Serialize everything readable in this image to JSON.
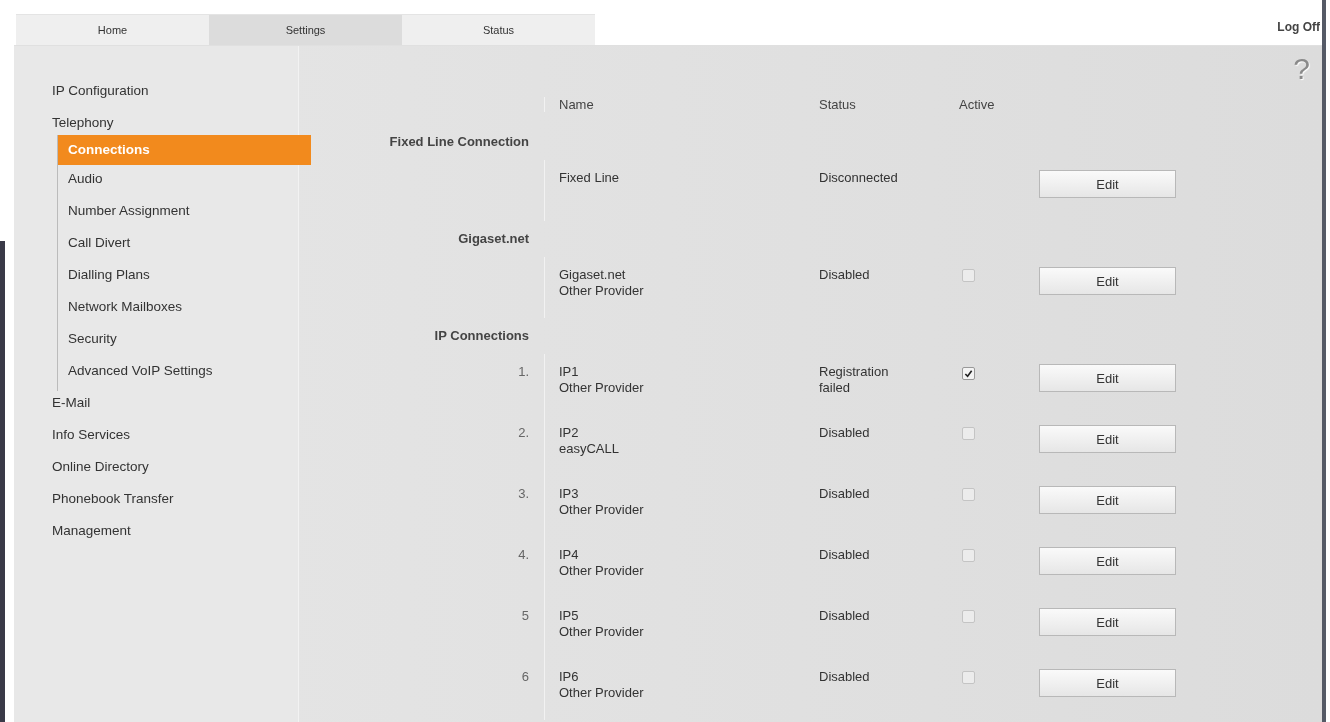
{
  "tabs": [
    {
      "label": "Home",
      "selected": false
    },
    {
      "label": "Settings",
      "selected": true
    },
    {
      "label": "Status",
      "selected": false
    }
  ],
  "log_off": "Log Off",
  "help": "?",
  "sidebar": {
    "items": [
      {
        "label": "IP Configuration",
        "selected": false
      },
      {
        "label": "Telephony",
        "selected": false,
        "children": [
          {
            "label": "Connections",
            "selected": true
          },
          {
            "label": "Audio",
            "selected": false
          },
          {
            "label": "Number Assignment",
            "selected": false
          },
          {
            "label": "Call Divert",
            "selected": false
          },
          {
            "label": "Dialling Plans",
            "selected": false
          },
          {
            "label": "Network Mailboxes",
            "selected": false
          },
          {
            "label": "Security",
            "selected": false
          },
          {
            "label": "Advanced VoIP Settings",
            "selected": false
          }
        ]
      },
      {
        "label": "E-Mail",
        "selected": false
      },
      {
        "label": "Info Services",
        "selected": false
      },
      {
        "label": "Online Directory",
        "selected": false
      },
      {
        "label": "Phonebook Transfer",
        "selected": false
      },
      {
        "label": "Management",
        "selected": false
      }
    ]
  },
  "table": {
    "columns": [
      "Name",
      "Status",
      "Active"
    ],
    "sections": [
      {
        "title": "Fixed Line Connection",
        "rows": [
          {
            "name": [
              "Fixed Line"
            ],
            "status": "Disconnected",
            "button": "Edit"
          }
        ]
      },
      {
        "title": "Gigaset.net",
        "rows": [
          {
            "name": [
              "Gigaset.net",
              "Other Provider"
            ],
            "status": "Disabled",
            "active": false,
            "button": "Edit"
          }
        ]
      },
      {
        "title": "IP Connections",
        "rows": [
          {
            "number": "1.",
            "name": [
              "IP1",
              "Other Provider"
            ],
            "status": "Registration failed",
            "active": true,
            "button": "Edit"
          },
          {
            "number": "2.",
            "name": [
              "IP2",
              "easyCALL"
            ],
            "status": "Disabled",
            "active": false,
            "button": "Edit"
          },
          {
            "number": "3.",
            "name": [
              "IP3",
              "Other Provider"
            ],
            "status": "Disabled",
            "active": false,
            "button": "Edit"
          },
          {
            "number": "4.",
            "name": [
              "IP4",
              "Other Provider"
            ],
            "status": "Disabled",
            "active": false,
            "button": "Edit"
          },
          {
            "number": "5",
            "name": [
              "IP5",
              "Other Provider"
            ],
            "status": "Disabled",
            "active": false,
            "button": "Edit"
          },
          {
            "number": "6",
            "name": [
              "IP6",
              "Other Provider"
            ],
            "status": "Disabled",
            "active": false,
            "button": "Edit"
          }
        ]
      }
    ]
  }
}
